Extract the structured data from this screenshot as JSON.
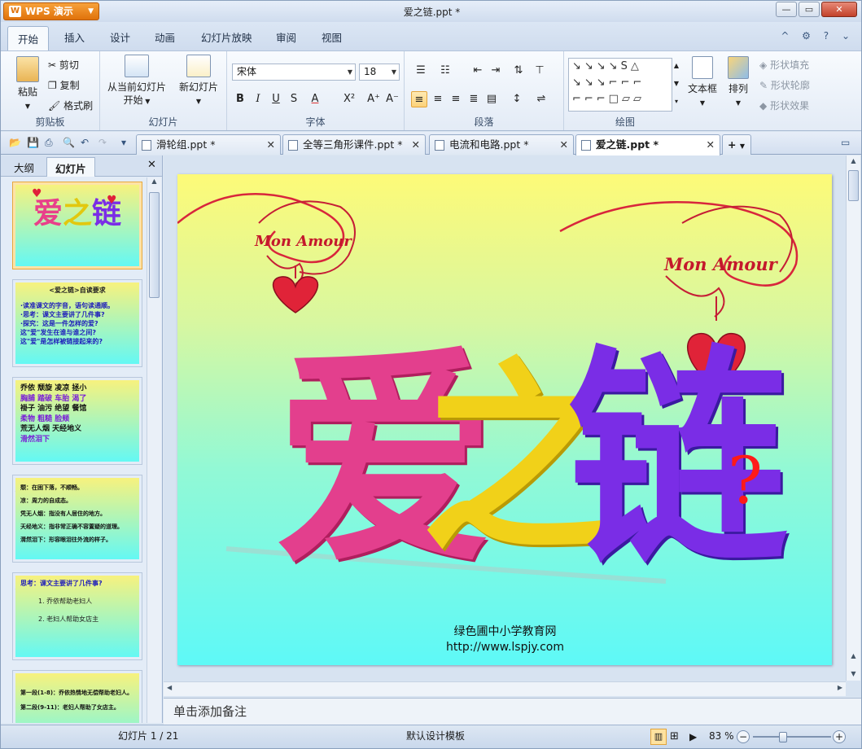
{
  "app": {
    "name": "WPS 演示",
    "title": "爱之链.ppt *"
  },
  "window_controls": {
    "minimize": "—",
    "maximize": "▭",
    "close": "✕"
  },
  "ribbon_tabs": [
    "开始",
    "插入",
    "设计",
    "动画",
    "幻灯片放映",
    "审阅",
    "视图"
  ],
  "ribbon": {
    "clipboard": {
      "label": "剪贴板",
      "paste": "粘贴",
      "cut": "剪切",
      "copy": "复制",
      "format_painter": "格式刷"
    },
    "slides": {
      "label": "幻灯片",
      "from_current_1": "从当前幻灯片",
      "from_current_2": "开始",
      "new_slide": "新幻灯片"
    },
    "font": {
      "label": "字体",
      "family": "宋体",
      "size": "18"
    },
    "paragraph": {
      "label": "段落"
    },
    "drawing": {
      "label": "绘图",
      "textbox": "文本框",
      "arrange": "排列",
      "shape_fill": "形状填充",
      "shape_outline": "形状轮廓",
      "shape_effect": "形状效果"
    }
  },
  "doc_tabs": [
    {
      "name": "滑轮组.ppt *",
      "active": false
    },
    {
      "name": "全等三角形课件.ppt *",
      "active": false
    },
    {
      "name": "电流和电路.ppt *",
      "active": false
    },
    {
      "name": "爱之链.ppt *",
      "active": true
    }
  ],
  "left_panel": {
    "tab_outline": "大纲",
    "tab_slides": "幻灯片"
  },
  "thumbnails": [
    {
      "num": "1",
      "title": "爱之链"
    },
    {
      "num": "2",
      "lines": [
        "<爱之链>自读要求",
        "·读准课文的字音，语句读通顺。",
        "·思考：课文主要讲了几件事?",
        "·探究：这是一件怎样的爱?",
        "这\"爱\"发生在谁与谁之间?",
        "这\"爱\"是怎样被链接起来的?"
      ]
    },
    {
      "num": "3",
      "lines": [
        "乔依  颓旋  凌凉  拯小",
        "胸脯  踏破  车胎  渴了",
        "褂子  油污  绝望  餐馆",
        "柔物  粗糙  脸颊",
        "荒无人烟  天经地义",
        "滑然泪下"
      ]
    },
    {
      "num": "4",
      "lines": [
        "颓：在困下落，不顺畅。",
        "凉：周力的自成态。",
        "凭无人烟：指没有人居住的地方。",
        "天经地义：指非常正确不容置疑的道理。",
        "潸然泪下：形容眼泪往外流的样子。"
      ]
    },
    {
      "num": "5",
      "lines": [
        "思考：课文主要讲了几件事?",
        "1. 乔依帮助老妇人",
        "2. 老妇人帮助女店主"
      ]
    },
    {
      "num": "6",
      "lines": [
        "第一段(1-8)：乔依热情地无偿帮助老妇人。",
        "第二段(9-11)：老妇人帮助了女店主。"
      ]
    }
  ],
  "slide": {
    "chars": [
      "爱",
      "之",
      "链"
    ],
    "question": "?",
    "decor_text": "Mon Amour",
    "footer_1": "绿色圃中小学教育网",
    "footer_2": "http://www.lspjy.com"
  },
  "notes_placeholder": "单击添加备注",
  "status": {
    "slide_counter": "幻灯片 1 / 21",
    "template": "默认设计模板",
    "zoom": "83 %"
  },
  "colors": {
    "accent_orange": "#f28a1a",
    "ribbon_blue": "#dce6f2",
    "char1": "#e8408a",
    "char2": "#f0d21a",
    "char3": "#7a2de6"
  }
}
